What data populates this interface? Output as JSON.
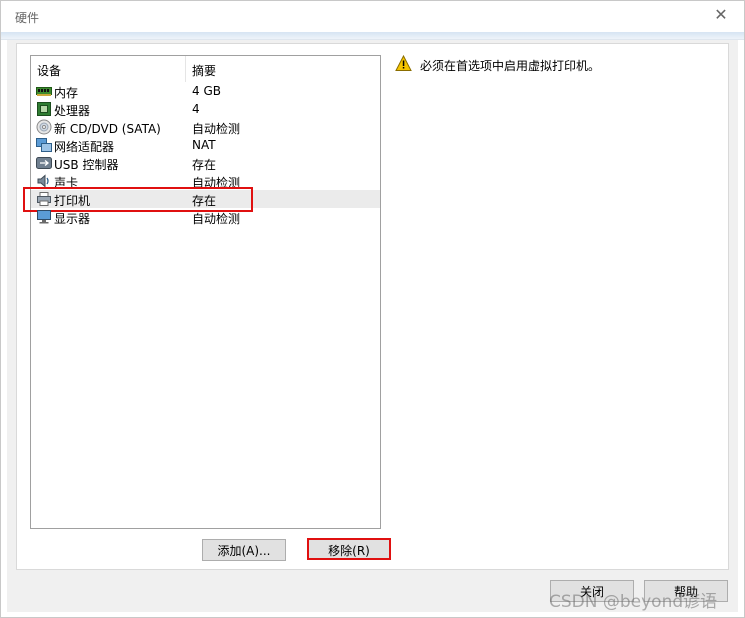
{
  "window": {
    "title": "硬件",
    "close_glyph": "✕"
  },
  "device_list": {
    "headers": {
      "device": "设备",
      "summary": "摘要"
    },
    "rows": [
      {
        "name": "内存",
        "summary": "4 GB",
        "icon": "memory-icon"
      },
      {
        "name": "处理器",
        "summary": "4",
        "icon": "processor-icon"
      },
      {
        "name": "新 CD/DVD (SATA)",
        "summary": "自动检测",
        "icon": "cd-dvd-icon"
      },
      {
        "name": "网络适配器",
        "summary": "NAT",
        "icon": "network-adapter-icon"
      },
      {
        "name": "USB 控制器",
        "summary": "存在",
        "icon": "usb-icon"
      },
      {
        "name": "声卡",
        "summary": "自动检测",
        "icon": "sound-card-icon"
      },
      {
        "name": "打印机",
        "summary": "存在",
        "icon": "printer-icon",
        "selected": true
      },
      {
        "name": "显示器",
        "summary": "自动检测",
        "icon": "display-icon"
      }
    ]
  },
  "buttons": {
    "add": "添加(A)...",
    "remove": "移除(R)",
    "close": "关闭",
    "help": "帮助"
  },
  "message": {
    "icon": "warning-icon",
    "text": "必须在首选项中启用虚拟打印机。"
  },
  "watermark": "CSDN @beyond谚语",
  "colors": {
    "highlight": "#e01010",
    "selected_row": "#ebebeb",
    "warning": "#f5c400"
  }
}
